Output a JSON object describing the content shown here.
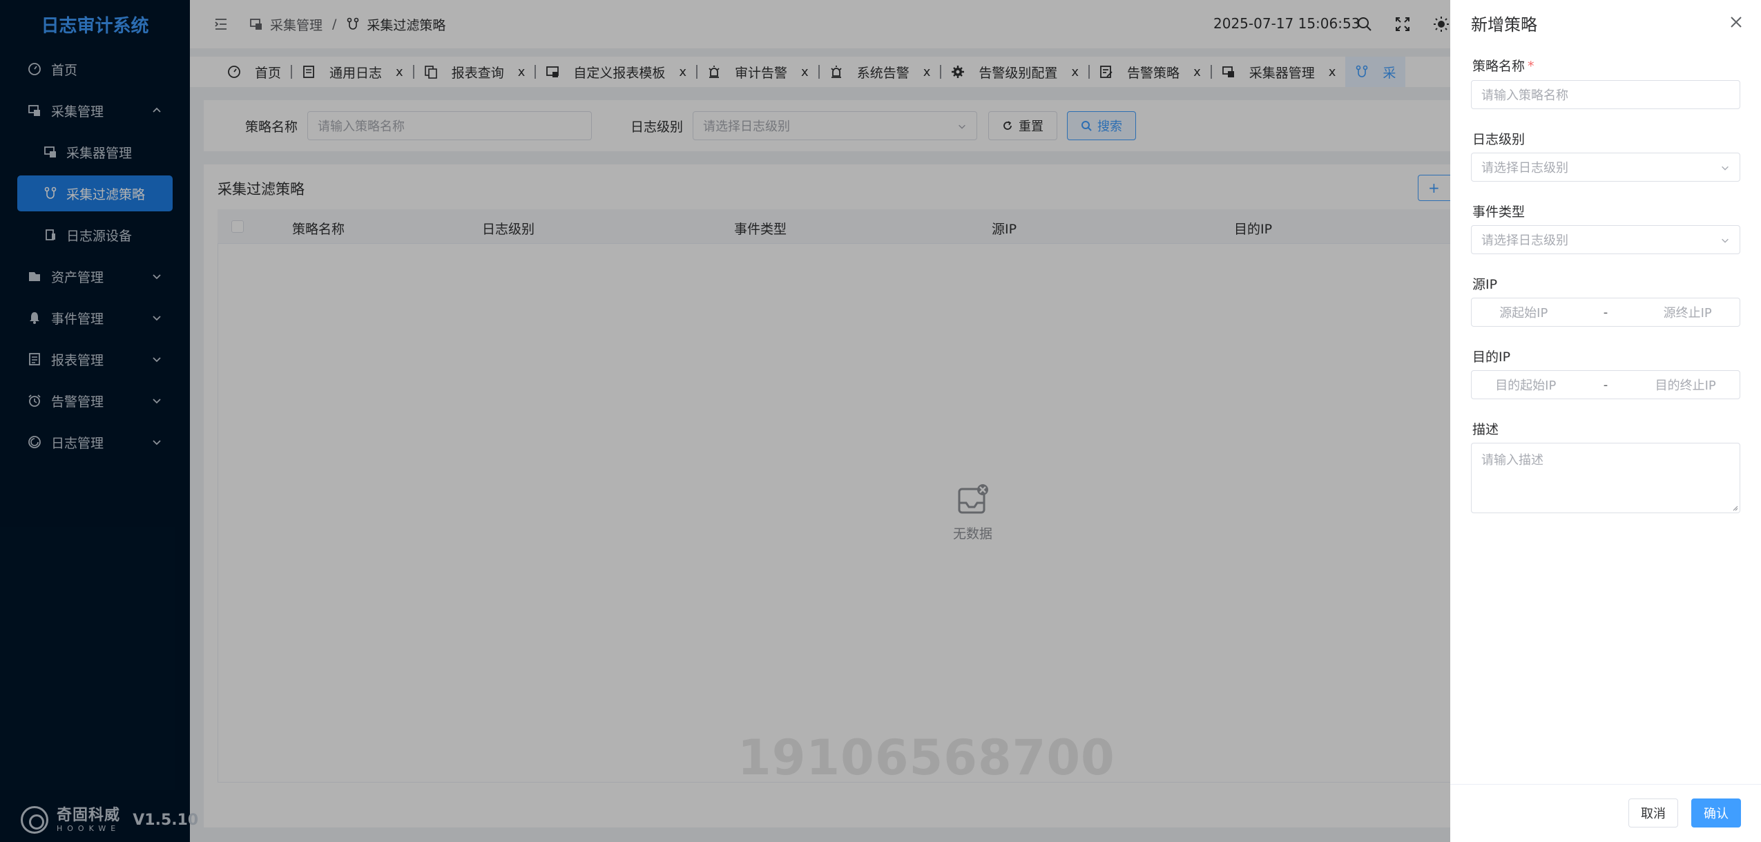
{
  "app": {
    "title": "日志审计系统",
    "version": "V1.5.10",
    "logo_cn": "奇固科威",
    "logo_en": "HOOKWE"
  },
  "sidebar": {
    "items": [
      {
        "label": "首页",
        "icon": "dashboard-icon"
      },
      {
        "label": "采集管理",
        "icon": "collector-icon",
        "expanded": true,
        "children": [
          {
            "label": "采集器管理",
            "icon": "collector-manage-icon"
          },
          {
            "label": "采集过滤策略",
            "icon": "filter-policy-icon",
            "active": true
          },
          {
            "label": "日志源设备",
            "icon": "device-icon"
          }
        ]
      },
      {
        "label": "资产管理",
        "icon": "asset-icon"
      },
      {
        "label": "事件管理",
        "icon": "bell-icon"
      },
      {
        "label": "报表管理",
        "icon": "report-icon"
      },
      {
        "label": "告警管理",
        "icon": "alarm-clock-icon"
      },
      {
        "label": "日志管理",
        "icon": "log-icon"
      }
    ]
  },
  "header": {
    "breadcrumb": [
      "采集管理",
      "采集过滤策略"
    ],
    "datetime": "2025-07-17 15:06:53"
  },
  "tabs": [
    {
      "label": "首页",
      "closable": false
    },
    {
      "label": "通用日志",
      "closable": true
    },
    {
      "label": "报表查询",
      "closable": true
    },
    {
      "label": "自定义报表模板",
      "closable": true
    },
    {
      "label": "审计告警",
      "closable": true
    },
    {
      "label": "系统告警",
      "closable": true
    },
    {
      "label": "告警级别配置",
      "closable": true
    },
    {
      "label": "告警策略",
      "closable": true
    },
    {
      "label": "采集器管理",
      "closable": true
    },
    {
      "label": "采",
      "closable": false,
      "active": true
    }
  ],
  "filter": {
    "name_label": "策略名称",
    "name_placeholder": "请输入策略名称",
    "level_label": "日志级别",
    "level_placeholder": "请选择日志级别",
    "reset_label": "重置",
    "search_label": "搜索"
  },
  "table": {
    "title": "采集过滤策略",
    "add_label": "+",
    "columns": [
      "策略名称",
      "日志级别",
      "事件类型",
      "源IP",
      "目的IP"
    ],
    "empty_text": "无数据"
  },
  "watermark": "19106568700",
  "drawer": {
    "title": "新增策略",
    "fields": {
      "name": {
        "label": "策略名称",
        "placeholder": "请输入策略名称",
        "required": true
      },
      "level": {
        "label": "日志级别",
        "placeholder": "请选择日志级别"
      },
      "event": {
        "label": "事件类型",
        "placeholder": "请选择日志级别"
      },
      "src_ip": {
        "label": "源IP",
        "start_placeholder": "源起始IP",
        "end_placeholder": "源终止IP",
        "sep": "-"
      },
      "dst_ip": {
        "label": "目的IP",
        "start_placeholder": "目的起始IP",
        "end_placeholder": "目的终止IP",
        "sep": "-"
      },
      "desc": {
        "label": "描述",
        "placeholder": "请输入描述"
      }
    },
    "cancel_label": "取消",
    "confirm_label": "确认"
  },
  "colors": {
    "primary": "#409eff",
    "sidebar_bg": "#001529",
    "active_menu": "#1f7fe6",
    "required": "#f56c6c"
  }
}
